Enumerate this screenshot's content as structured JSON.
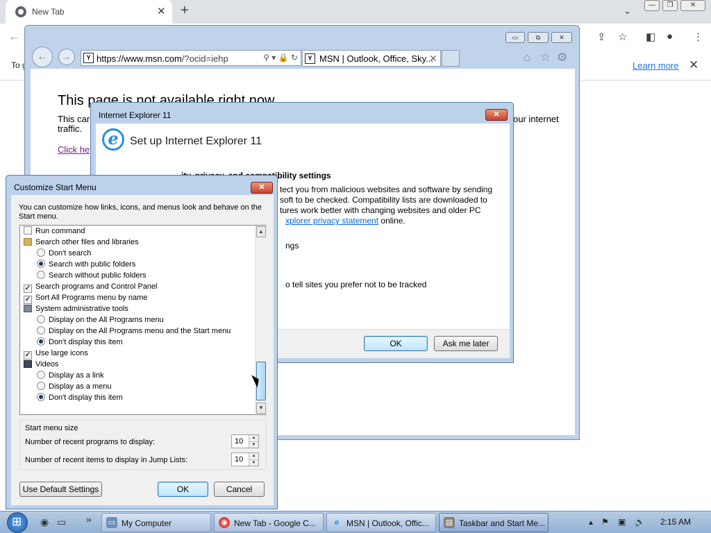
{
  "chrome": {
    "tab_title": "New Tab",
    "tab_close": "✕",
    "new_tab": "+",
    "chevron": "⌄",
    "win_min": "—",
    "win_restore": "❐",
    "win_close": "✕",
    "back_icon": "←",
    "infobar_text": "To g",
    "learn_more": "Learn more",
    "infobar_close": "✕",
    "toolbar_icons": [
      "search-icon",
      "share-icon",
      "star-icon",
      "sidebar-icon",
      "profile-icon",
      "menu-icon"
    ]
  },
  "ie": {
    "caption_min": "▭",
    "caption_max": "⧉",
    "caption_close": "✕",
    "url_host": "https://www.msn.com",
    "url_path": "/?ocid=iehp",
    "url_tools": "⚲ ▾ 🔒 ↻",
    "tab_title": "MSN | Outlook, Office, Sky...",
    "tab_close": "✕",
    "favicon_letter": "Y",
    "error_title": "This page is not available right now",
    "error_line1": "This car",
    "error_line1_right": "our internet",
    "error_line2": "traffic.",
    "error_link": "Click he"
  },
  "setup": {
    "title": "Internet Explorer 11",
    "heading": "Set up Internet Explorer 11",
    "line_bold": "ity, privacy, and compatibility settings",
    "line1": "tect you from malicious websites and software by sending",
    "line2": "soft to be checked. Compatibility lists are downloaded to",
    "line3": "tures work better with changing websites and older PC",
    "line4_link": "xplorer privacy statement",
    "line4_tail": " online.",
    "line5": "ngs",
    "line6": "o tell sites you prefer not to be tracked",
    "ok": "OK",
    "ask_later": "Ask me later",
    "close": "✕"
  },
  "csm": {
    "title": "Customize Start Menu",
    "close": "✕",
    "description": "You can customize how links, icons, and menus look and behave on the Start menu.",
    "items": [
      {
        "kind": "checkbox",
        "checked": false,
        "indent": 0,
        "label": "Run command"
      },
      {
        "kind": "folder",
        "indent": 0,
        "label": "Search other files and libraries"
      },
      {
        "kind": "radio",
        "checked": false,
        "indent": 1,
        "label": "Don't search"
      },
      {
        "kind": "radio",
        "checked": true,
        "indent": 1,
        "label": "Search with public folders"
      },
      {
        "kind": "radio",
        "checked": false,
        "indent": 1,
        "label": "Search without public folders"
      },
      {
        "kind": "checkbox",
        "checked": true,
        "indent": 0,
        "label": "Search programs and Control Panel"
      },
      {
        "kind": "checkbox",
        "checked": true,
        "indent": 0,
        "label": "Sort All Programs menu by name"
      },
      {
        "kind": "tools",
        "indent": 0,
        "label": "System administrative tools"
      },
      {
        "kind": "radio",
        "checked": false,
        "indent": 1,
        "label": "Display on the All Programs menu"
      },
      {
        "kind": "radio",
        "checked": false,
        "indent": 1,
        "label": "Display on the All Programs menu and the Start menu"
      },
      {
        "kind": "radio",
        "checked": true,
        "indent": 1,
        "label": "Don't display this item"
      },
      {
        "kind": "checkbox",
        "checked": true,
        "indent": 0,
        "label": "Use large icons"
      },
      {
        "kind": "video",
        "indent": 0,
        "label": "Videos"
      },
      {
        "kind": "radio",
        "checked": false,
        "indent": 1,
        "label": "Display as a link"
      },
      {
        "kind": "radio",
        "checked": false,
        "indent": 1,
        "label": "Display as a menu"
      },
      {
        "kind": "radio",
        "checked": true,
        "indent": 1,
        "label": "Don't display this item"
      }
    ],
    "size_group": "Start menu size",
    "recent_programs_label": "Number of recent programs to display:",
    "recent_programs_value": "10",
    "recent_items_label": "Number of recent items to display in Jump Lists:",
    "recent_items_value": "10",
    "use_default": "Use Default Settings",
    "ok": "OK",
    "cancel": "Cancel",
    "scroll_up": "▲",
    "scroll_down": "▼"
  },
  "taskbar": {
    "overflow": "»",
    "items": [
      {
        "label": "My Computer"
      },
      {
        "label": "New Tab - Google C..."
      },
      {
        "label": "MSN | Outlook, Offic..."
      },
      {
        "label": "Taskbar and Start Me..."
      }
    ],
    "tray_up": "▲",
    "time": "2:15 AM"
  }
}
